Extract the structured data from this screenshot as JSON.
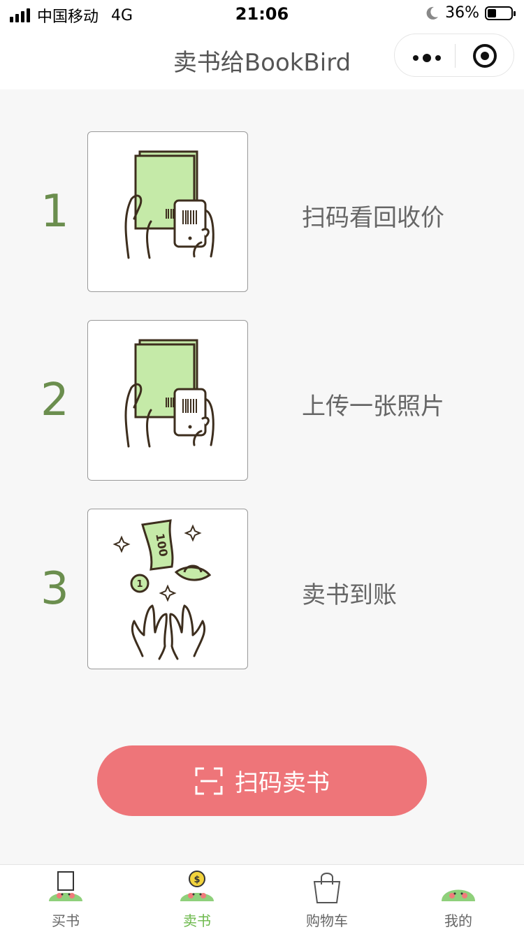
{
  "status_bar": {
    "carrier": "中国移动",
    "network": "4G",
    "time": "21:06",
    "battery_percent": "36%",
    "battery_level": 0.36
  },
  "navbar": {
    "title": "卖书给BookBird"
  },
  "steps": [
    {
      "number": "1",
      "label": "扫码看回收价",
      "icon": "book-barcode-scan-icon"
    },
    {
      "number": "2",
      "label": "上传一张照片",
      "icon": "book-photo-upload-icon"
    },
    {
      "number": "3",
      "label": "卖书到账",
      "icon": "money-hands-icon",
      "bill_text": "100",
      "coin_text": "1"
    }
  ],
  "scan_button": {
    "label": "扫码卖书",
    "icon": "scan-frame-icon",
    "color": "#ee7579"
  },
  "tabbar": {
    "active_color": "#6bb84a",
    "items": [
      {
        "label": "买书",
        "icon": "buy-bird-icon"
      },
      {
        "label": "卖书",
        "icon": "sell-bird-coin-icon",
        "active": true,
        "coin_text": "$"
      },
      {
        "label": "购物车",
        "icon": "shopping-bag-icon"
      },
      {
        "label": "我的",
        "icon": "profile-bird-icon"
      }
    ]
  }
}
